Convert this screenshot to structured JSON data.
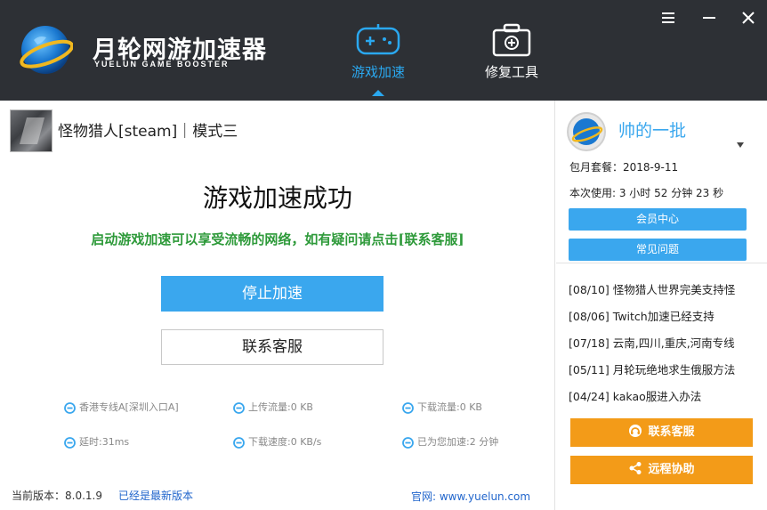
{
  "header": {
    "brand_cn": "月轮网游加速器",
    "brand_en": "YUELUN GAME BOOSTER",
    "tabs": [
      {
        "label": "游戏加速",
        "icon": "gamepad-icon",
        "active": true
      },
      {
        "label": "修复工具",
        "icon": "toolbox-icon",
        "active": false
      }
    ],
    "window_controls": [
      "menu-icon",
      "minimize-icon",
      "close-icon"
    ]
  },
  "main": {
    "game_title": "怪物猎人[steam]｜模式三",
    "success_title": "游戏加速成功",
    "success_subtitle": "启动游戏加速可以享受流畅的网络，如有疑问请点击[联系客服]",
    "stop_button": "停止加速",
    "contact_button": "联系客服",
    "stats": {
      "line": "香港专线A[深圳入口A]",
      "upload": "上传流量:0 KB",
      "download": "下载流量:0 KB",
      "latency": "延时:31ms",
      "speed": "下载速度:0 KB/s",
      "accelerated": "已为您加速:2 分钟"
    },
    "footer": {
      "version": "当前版本：8.0.1.9",
      "latest": "已经是最新版本",
      "site": "官网: www.yuelun.com"
    }
  },
  "side": {
    "username": "帅的一批",
    "plan": "包月套餐：2018-9-11",
    "usage": "本次使用: 3 小时 52 分钟 23 秒",
    "member_button": "会员中心",
    "faq_button": "常见问题",
    "news": [
      "[08/10] 怪物猎人世界完美支持怪",
      "[08/06] Twitch加速已经支持",
      "[07/18] 云南,四川,重庆,河南专线",
      "[05/11] 月轮玩绝地求生俄服方法",
      "[04/24] kakao服进入办法"
    ],
    "contact_service_button": "联系客服",
    "remote_assist_button": "远程协助"
  },
  "colors": {
    "header_bg": "#2d3035",
    "accent_blue": "#3aa7ee",
    "success_green": "#2e9a3a",
    "orange": "#f39b18"
  }
}
